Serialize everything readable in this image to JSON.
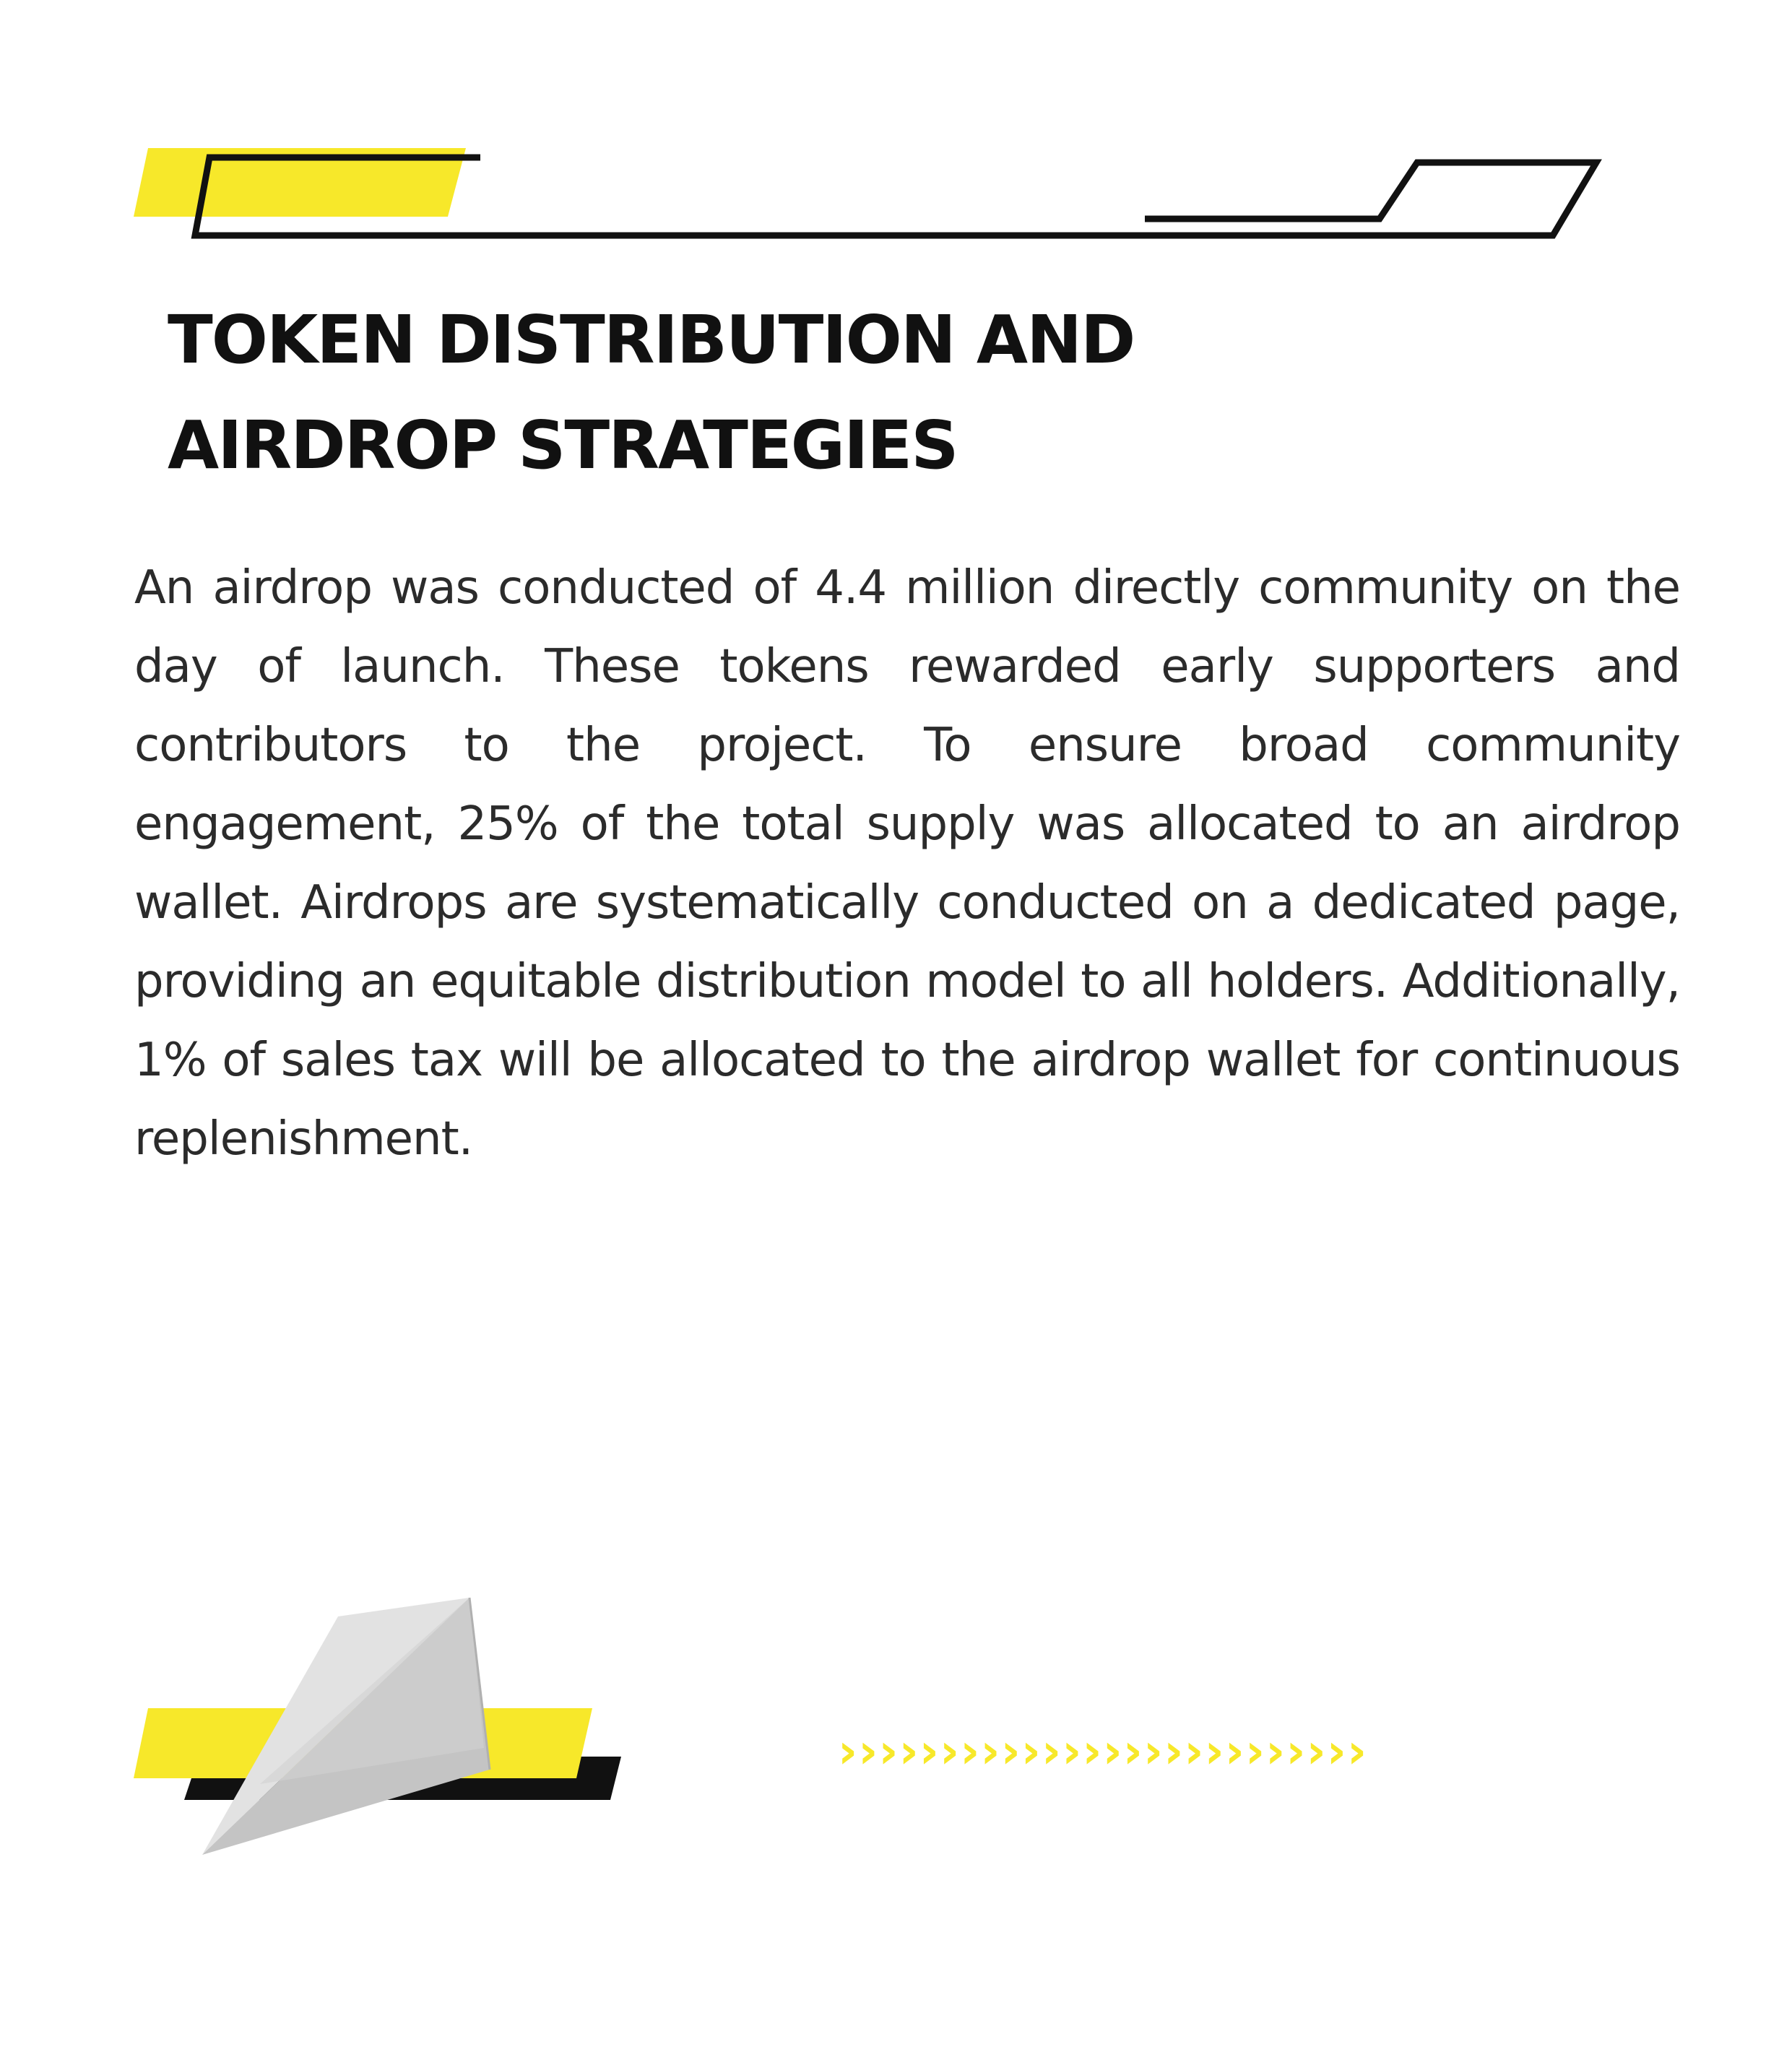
{
  "heading": {
    "line1": "TOKEN DISTRIBUTION AND",
    "line2": "AIRDROP STRATEGIES"
  },
  "body": {
    "paragraph": "An airdrop was conducted of 4.4 million directly community on the day of launch. These tokens rewarded early supporters and contributors to the project. To ensure broad community engagement, 25% of the total supply was allocated to an airdrop wallet. Airdrops are systematically conducted on a dedicated page, providing an equitable distribution model to all holders. Additionally, 1% of sales tax will be allocated to the airdrop wallet for continuous replenishment."
  },
  "decor": {
    "chevrons": "››››››››››››››››››››››››››",
    "accent_color": "#f7e82a",
    "line_color": "#111111",
    "paper_plane_icon": "paper-plane-icon"
  }
}
